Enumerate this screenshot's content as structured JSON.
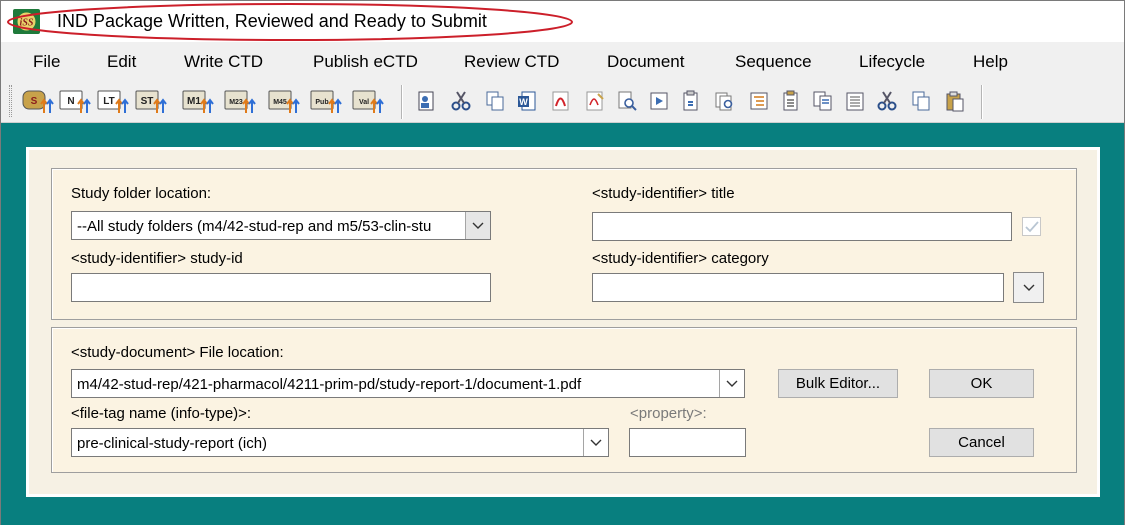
{
  "window": {
    "title": "IND Package Written, Reviewed and Ready to Submit",
    "logo_text": "iSS"
  },
  "menu": [
    "File",
    "Edit",
    "Write CTD",
    "Publish eCTD",
    "Review CTD",
    "Document",
    "Sequence",
    "Lifecycle",
    "Help"
  ],
  "toolbar": {
    "publish_icons": [
      {
        "name": "sequence-publish-icon",
        "label": "S"
      },
      {
        "name": "new-publish-icon",
        "label": "N"
      },
      {
        "name": "lt-publish-icon",
        "label": "LT"
      },
      {
        "name": "st-publish-icon",
        "label": "ST"
      },
      {
        "name": "m1-publish-icon",
        "label": "M1"
      },
      {
        "name": "m23-publish-icon",
        "label": "M23"
      },
      {
        "name": "m45-publish-icon",
        "label": "M45"
      },
      {
        "name": "pub-publish-icon",
        "label": "Pub"
      },
      {
        "name": "val-publish-icon",
        "label": "Val"
      }
    ]
  },
  "study": {
    "folder_label": "Study folder location:",
    "folder_value": "--All study folders (m4/42-stud-rep and m5/53-clin-stu",
    "title_label": "<study-identifier> title",
    "title_value": "",
    "studyid_label": "<study-identifier> study-id",
    "studyid_value": "",
    "category_label": "<study-identifier> category",
    "category_value": "",
    "title_checked": true
  },
  "document": {
    "file_location_label": "<study-document> File location:",
    "file_location_value": "m4/42-stud-rep/421-pharmacol/4211-prim-pd/study-report-1/document-1.pdf",
    "file_tag_label": "<file-tag name (info-type)>:",
    "file_tag_value": "pre-clinical-study-report (ich)",
    "property_label": "<property>:",
    "property_value": ""
  },
  "buttons": {
    "bulk_editor": "Bulk Editor...",
    "ok": "OK",
    "cancel": "Cancel"
  },
  "colors": {
    "workspace": "#087f7f",
    "annotation_oval": "#cc1f2a",
    "dialog_bg": "#f6f1e4"
  }
}
